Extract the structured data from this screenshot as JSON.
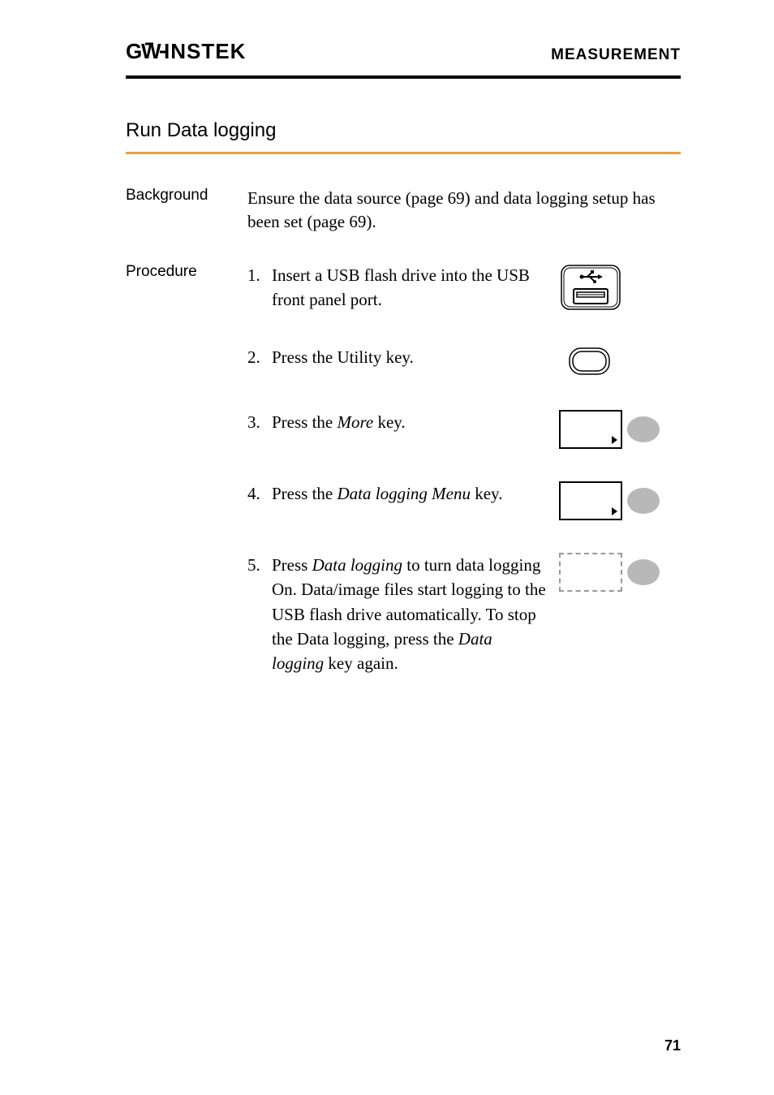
{
  "header": {
    "logo": "GWINSTEK",
    "title": "MEASUREMENT"
  },
  "section": {
    "title": "Run Data logging"
  },
  "background": {
    "label": "Background",
    "text": "Ensure the data source (page 69) and data logging setup has been set (page 69)."
  },
  "procedure": {
    "label": "Procedure",
    "steps": [
      {
        "num": "1.",
        "text": "Insert a USB flash drive into the USB front panel port."
      },
      {
        "num": "2.",
        "text": "Press the Utility key."
      },
      {
        "num": "3.",
        "text_before": "Press the ",
        "italic": "More",
        "text_after": " key."
      },
      {
        "num": "4.",
        "text_before": "Press the ",
        "italic": "Data logging Menu",
        "text_after": " key."
      },
      {
        "num": "5.",
        "text_before": "Press ",
        "italic1": "Data logging",
        "text_mid": " to turn data logging On. Data/image files start logging to the USB flash drive automatically. To stop the Data logging, press the ",
        "italic2": "Data logging",
        "text_after": " key again."
      }
    ]
  },
  "page_number": "71"
}
